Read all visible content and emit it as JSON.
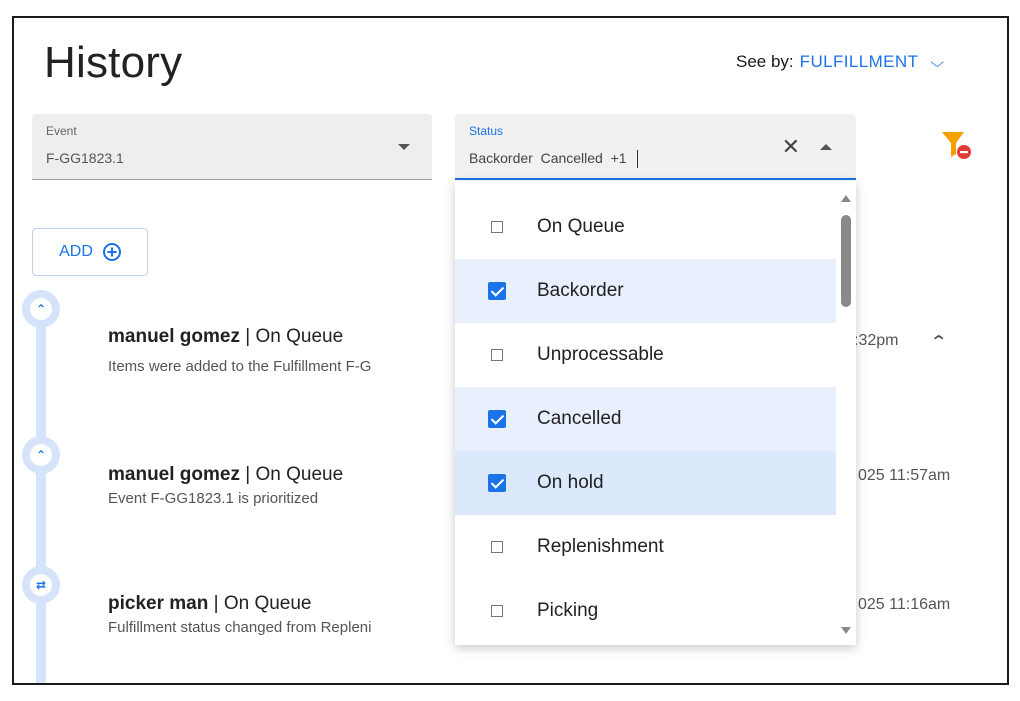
{
  "header": {
    "title": "History",
    "see_by_label": "See by:",
    "see_by_value": "FULFILLMENT"
  },
  "filters": {
    "event": {
      "label": "Event",
      "value": "F-GG1823.1"
    },
    "status": {
      "label": "Status",
      "value": "Backorder  Cancelled  +1"
    }
  },
  "actions": {
    "add_label": "ADD"
  },
  "entries": [
    {
      "user": "manuel gomez",
      "status": " | On Queue",
      "description": "Items were added to the Fulfillment F-G",
      "timestamp": ":32pm"
    },
    {
      "user": "manuel gomez",
      "status": " | On Queue",
      "description": "Event F-GG1823.1 is prioritized",
      "timestamp": "025 11:57am"
    },
    {
      "user": "picker man",
      "status": " | On Queue",
      "description": "Fulfillment status changed from Repleni",
      "timestamp": "025 11:16am"
    }
  ],
  "status_options": [
    {
      "label": "On Queue",
      "checked": false
    },
    {
      "label": "Backorder",
      "checked": true
    },
    {
      "label": "Unprocessable",
      "checked": false
    },
    {
      "label": "Cancelled",
      "checked": true
    },
    {
      "label": "On hold",
      "checked": true
    },
    {
      "label": "Replenishment",
      "checked": false
    },
    {
      "label": "Picking",
      "checked": false
    }
  ],
  "colors": {
    "accent": "#1a73e8",
    "filter_icon": "#f5a000",
    "filter_badge": "#e53935",
    "timeline": "#d6e4fb"
  },
  "icons": [
    "chevron-down-icon",
    "dropdown-caret-icon",
    "clear-icon",
    "filter-remove-icon",
    "add-circle-icon",
    "chevron-up-icon",
    "swap-icon"
  ]
}
